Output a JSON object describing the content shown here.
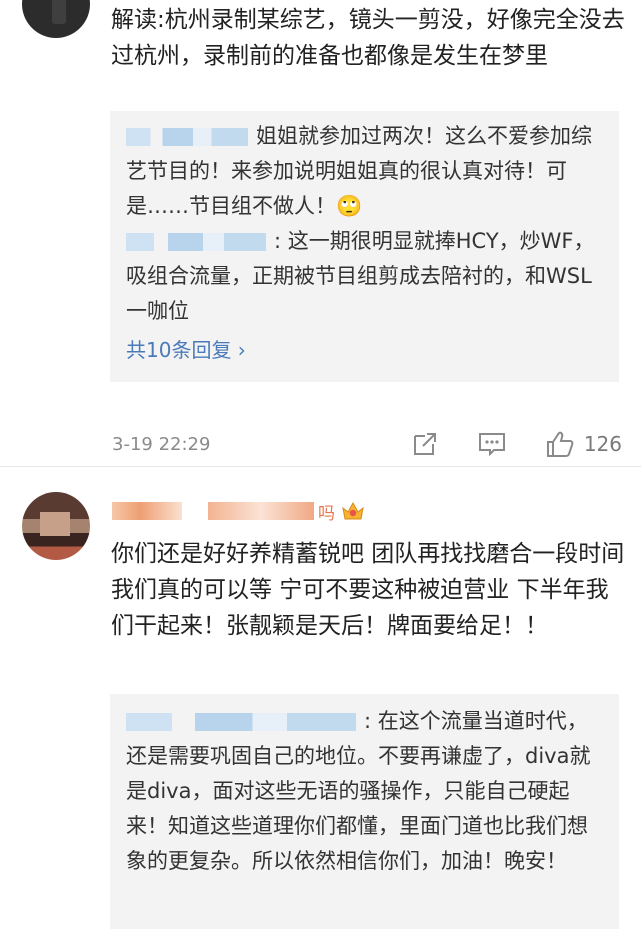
{
  "comment1": {
    "text": "解读:杭州录制某综艺，镜头一剪没，好像完全没去过杭州，录制前的准备也都像是发生在梦里",
    "replies": [
      "姐姐就参加过两次！这么不爱参加综艺节目的！来参加说明姐姐真的很认真对待！可是……节目组不做人！🙄",
      ": 这一期很明显就捧HCY，炒WF，吸组合流量，正期被节目组剪成去陪衬的，和WSL一咖位"
    ],
    "more_replies": "共10条回复 ›",
    "time": "3-19 22:29",
    "like_count": "126"
  },
  "comment2": {
    "username_suffix": "吗",
    "text": "你们还是好好养精蓄锐吧 团队再找找磨合一段时间 我们真的可以等 宁可不要这种被迫营业 下半年我们干起来！张靓颖是天后！牌面要给足！！",
    "replies": [
      ": 在这个流量当道时代， 还是需要巩固自己的地位。不要再谦虚了，diva就是diva，面对这些无语的骚操作，只能自己硬起来！知道这些道理你们都懂，里面门道也比我们想象的更复杂。所以依然相信你们，加油！晚安！"
    ]
  },
  "colors": {
    "link": "#4a7aba",
    "meta": "#8a8a8a",
    "reply_bg": "#f3f3f3",
    "username_orange": "#e8774d"
  }
}
